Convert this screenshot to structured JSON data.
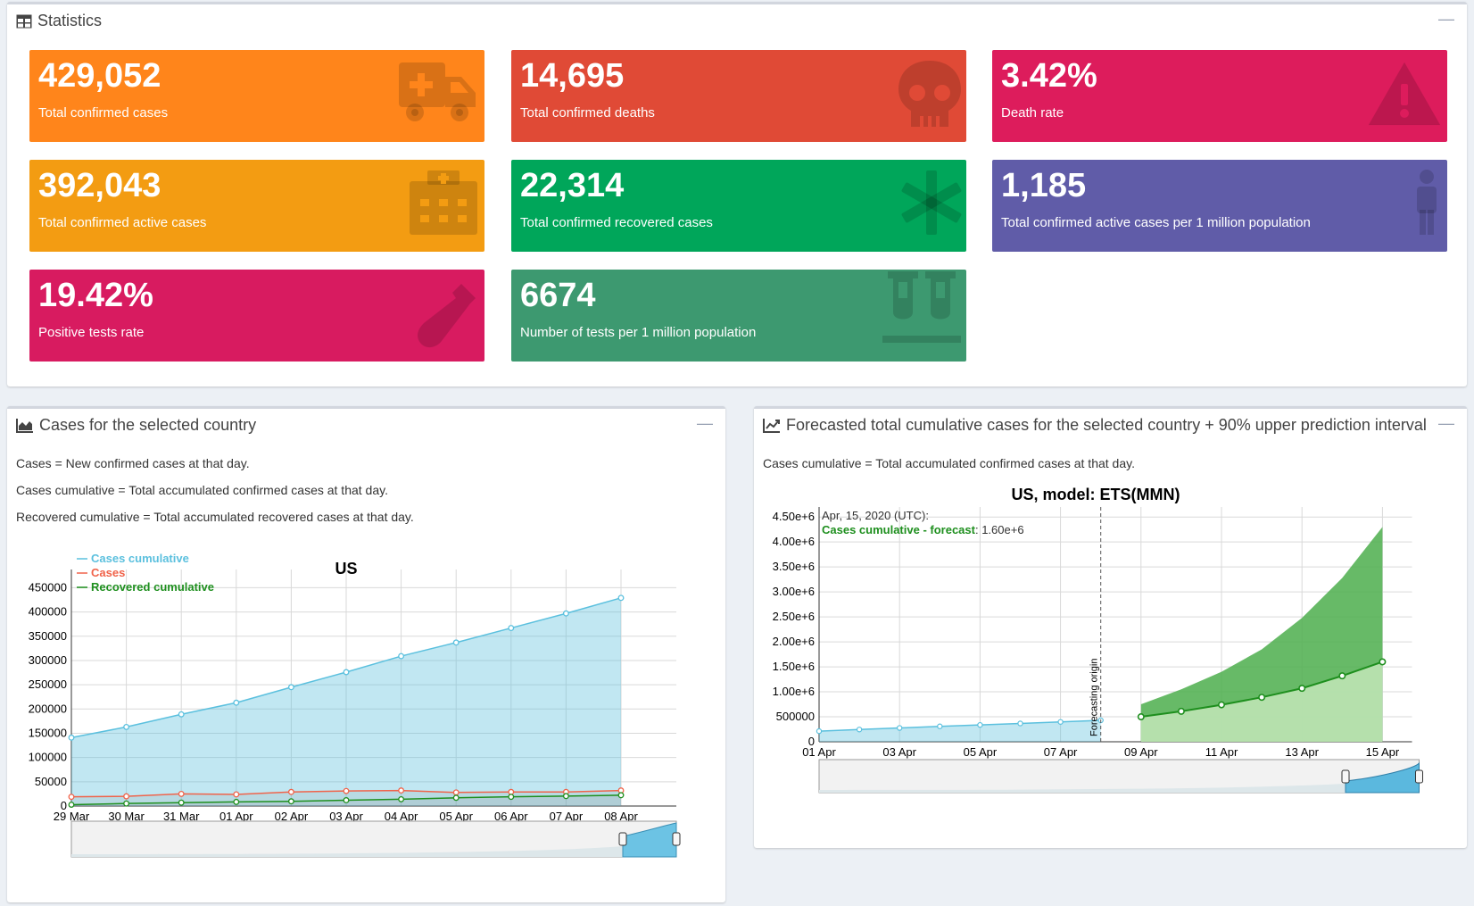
{
  "statistics": {
    "title": "Statistics",
    "tiles": [
      {
        "value": "429,052",
        "label": "Total confirmed cases",
        "color": "#ff851b",
        "icon": "ambulance-icon"
      },
      {
        "value": "14,695",
        "label": "Total confirmed deaths",
        "color": "#e04a36",
        "icon": "skull-icon"
      },
      {
        "value": "3.42%",
        "label": "Death rate",
        "color": "#dd1c5c",
        "icon": "warning-icon"
      },
      {
        "value": "392,043",
        "label": "Total confirmed active cases",
        "color": "#f39c12",
        "icon": "hospital-icon"
      },
      {
        "value": "22,314",
        "label": "Total confirmed recovered cases",
        "color": "#00a65a",
        "icon": "asterisk-icon"
      },
      {
        "value": "1,185",
        "label": "Total confirmed active cases per 1 million population",
        "color": "#605ca8",
        "icon": "person-icon"
      },
      {
        "value": "19.42%",
        "label": "Positive tests rate",
        "color": "#d81b60",
        "icon": "test-tube-icon"
      },
      {
        "value": "6674",
        "label": "Number of tests per 1 million population",
        "color": "#3d9970",
        "icon": "test-tubes-icon"
      }
    ]
  },
  "cases_panel": {
    "title": "Cases for the selected country",
    "descriptions": [
      "Cases = New confirmed cases at that day.",
      "Cases cumulative = Total accumulated confirmed cases at that day.",
      "Recovered cumulative = Total accumulated recovered cases at that day."
    ]
  },
  "forecast_panel": {
    "title": "Forecasted total cumulative cases for the selected country + 90% upper prediction interval",
    "descriptions": [
      "Cases cumulative = Total accumulated confirmed cases at that day."
    ]
  },
  "chart_data": [
    {
      "type": "line",
      "title": "US",
      "x": [
        "29 Mar",
        "30 Mar",
        "31 Mar",
        "01 Apr",
        "02 Apr",
        "03 Apr",
        "04 Apr",
        "05 Apr",
        "06 Apr",
        "07 Apr",
        "08 Apr"
      ],
      "y_ticks": [
        "0",
        "50000",
        "100000",
        "150000",
        "200000",
        "250000",
        "300000",
        "350000",
        "400000",
        "450000"
      ],
      "ylim": [
        0,
        460000
      ],
      "legend": "top-left",
      "series": [
        {
          "name": "Cases cumulative",
          "color": "#5bc0de",
          "fill": true,
          "values": [
            141000,
            163000,
            189000,
            213000,
            245000,
            276000,
            309000,
            337000,
            367000,
            397000,
            429052
          ]
        },
        {
          "name": "Cases",
          "color": "#f0634a",
          "fill": false,
          "values": [
            19000,
            20000,
            25000,
            24000,
            29000,
            31000,
            32000,
            28000,
            29000,
            29000,
            32000
          ]
        },
        {
          "name": "Recovered cumulative",
          "color": "#1e8f1e",
          "fill": false,
          "values": [
            2700,
            5200,
            7000,
            8500,
            9700,
            12000,
            14000,
            17000,
            19000,
            20500,
            22314
          ]
        }
      ]
    },
    {
      "type": "area",
      "title": "US, model: ETS(MMN)",
      "x_ticks": [
        "01 Apr",
        "03 Apr",
        "05 Apr",
        "07 Apr",
        "09 Apr",
        "11 Apr",
        "13 Apr",
        "15 Apr"
      ],
      "y_ticks": [
        "0",
        "500000",
        "1.00e+6",
        "1.50e+6",
        "2.00e+6",
        "2.50e+6",
        "3.00e+6",
        "3.50e+6",
        "4.00e+6",
        "4.50e+6"
      ],
      "ylim": [
        0,
        4700000
      ],
      "annotation": "Forecasting origin",
      "tooltip": {
        "date": "Apr, 15, 2020 (UTC):",
        "series": "Cases cumulative - forecast",
        "value": "1.60e+6"
      },
      "series": [
        {
          "name": "Cases cumulative",
          "color": "#5bc0de",
          "x": [
            "01 Apr",
            "02 Apr",
            "03 Apr",
            "04 Apr",
            "05 Apr",
            "06 Apr",
            "07 Apr",
            "08 Apr"
          ],
          "values": [
            213000,
            245000,
            276000,
            309000,
            337000,
            367000,
            397000,
            429052
          ]
        },
        {
          "name": "Cases cumulative - forecast",
          "color": "#1e8f1e",
          "x": [
            "09 Apr",
            "10 Apr",
            "11 Apr",
            "12 Apr",
            "13 Apr",
            "14 Apr",
            "15 Apr"
          ],
          "values": [
            500000,
            610000,
            740000,
            890000,
            1070000,
            1320000,
            1600000
          ]
        },
        {
          "name": "upper prediction interval",
          "color": "#4cae4c",
          "x": [
            "09 Apr",
            "10 Apr",
            "11 Apr",
            "12 Apr",
            "13 Apr",
            "14 Apr",
            "15 Apr"
          ],
          "values": [
            750000,
            1050000,
            1400000,
            1850000,
            2480000,
            3280000,
            4300000
          ]
        }
      ]
    }
  ]
}
